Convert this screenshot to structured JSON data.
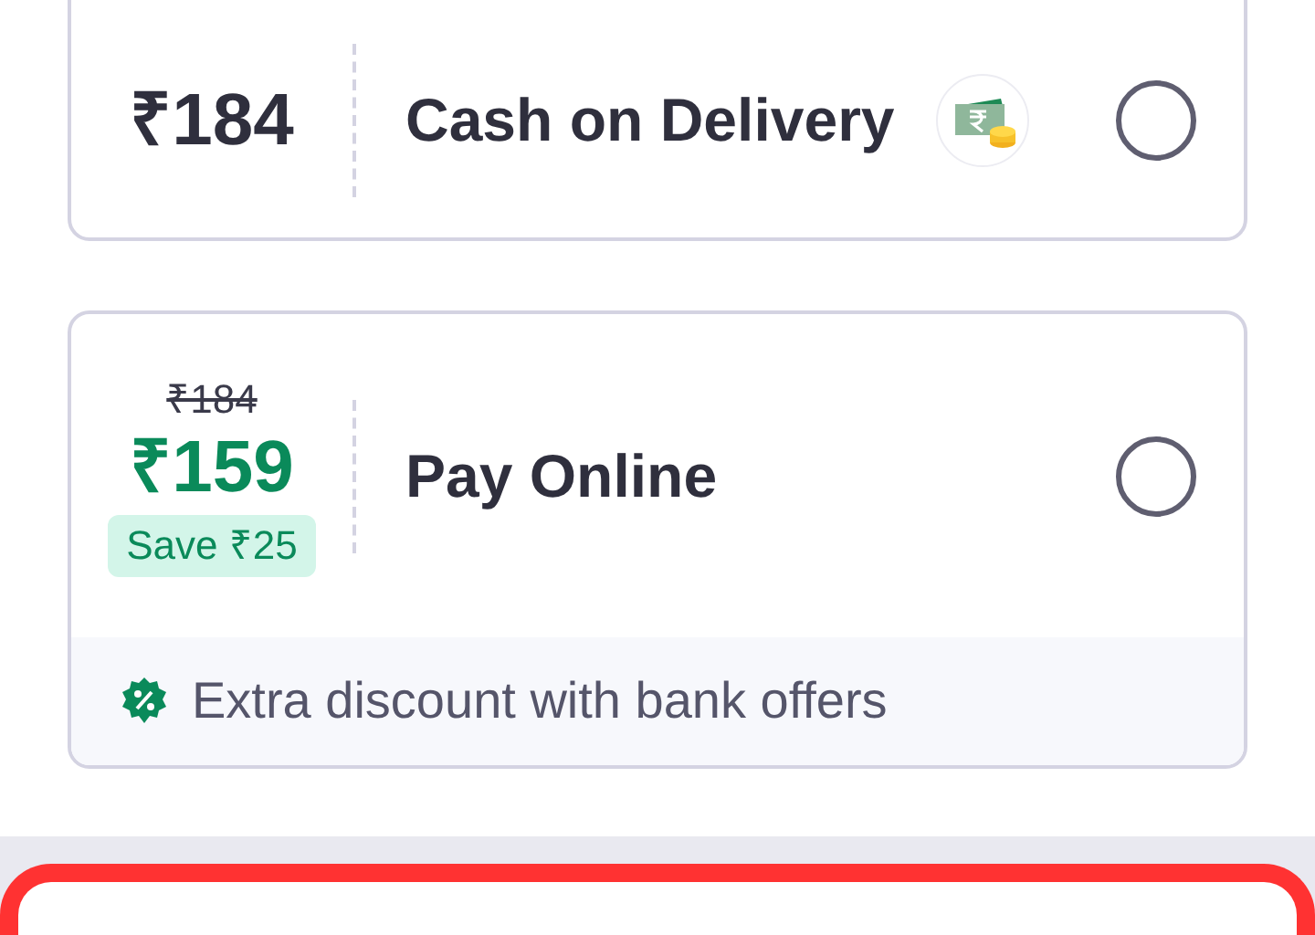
{
  "payment_options": [
    {
      "kind": "cod",
      "price": "₹184",
      "label": "Cash on Delivery",
      "selected": false
    },
    {
      "kind": "online",
      "original_price": "₹184",
      "price": "₹159",
      "save_badge": "Save ₹25",
      "label": "Pay Online",
      "selected": false,
      "offer": "Extra discount with bank offers"
    }
  ]
}
